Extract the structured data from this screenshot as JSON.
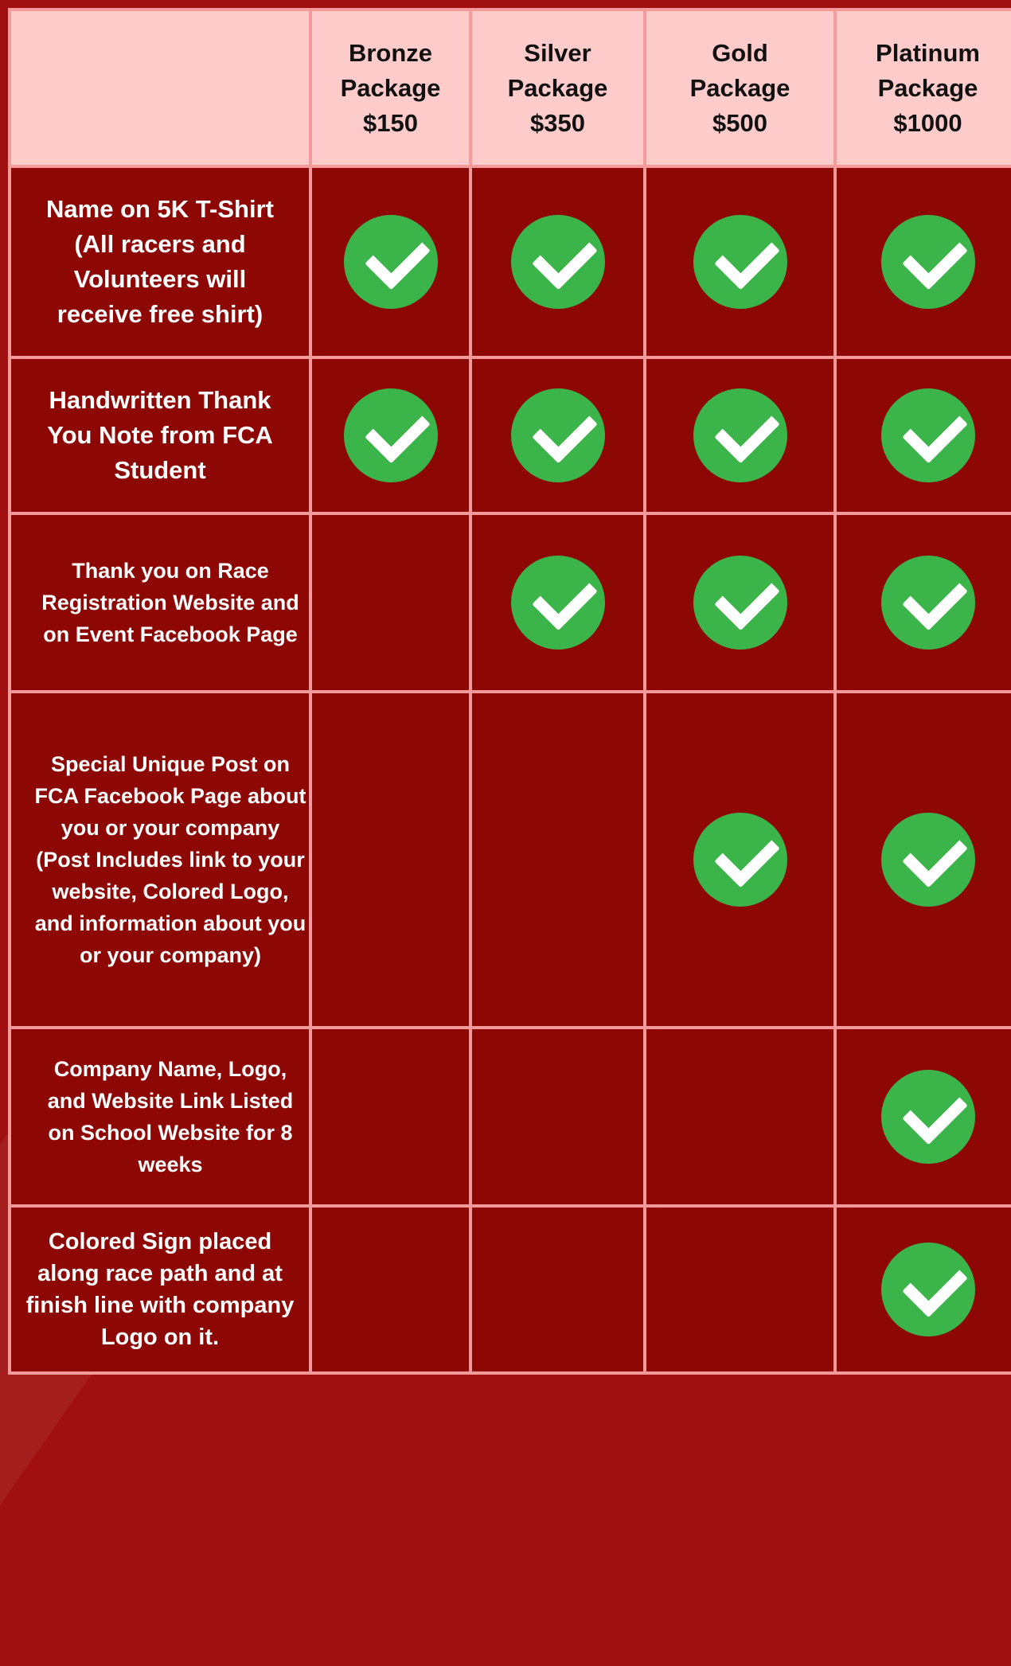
{
  "header": {
    "packages": [
      {
        "line1": "Bronze",
        "line2": "Package",
        "price": "$150"
      },
      {
        "line1": "Silver",
        "line2": "Package",
        "price": "$350"
      },
      {
        "line1": "Gold",
        "line2": "Package",
        "price": "$500"
      },
      {
        "line1": "Platinum",
        "line2": "Package",
        "price": "$1000"
      }
    ]
  },
  "rows": [
    {
      "feature": "Name on 5K T-Shirt (All racers and Volunteers will receive free shirt)",
      "included": [
        true,
        true,
        true,
        true
      ]
    },
    {
      "feature": "Handwritten Thank You Note from FCA Student",
      "included": [
        true,
        true,
        true,
        true
      ]
    },
    {
      "feature": "Thank you on Race Registration Website and on Event Facebook Page",
      "included": [
        false,
        true,
        true,
        true
      ]
    },
    {
      "feature": "Special Unique Post on FCA Facebook Page about you or your company (Post Includes link to your website, Colored Logo, and information about you or your company)",
      "included": [
        false,
        false,
        true,
        true
      ]
    },
    {
      "feature": "Company Name, Logo, and Website Link Listed on School Website for 8 weeks",
      "included": [
        false,
        false,
        false,
        true
      ]
    },
    {
      "feature": "Colored Sign placed along race path and at finish line with company Logo on it.",
      "included": [
        false,
        false,
        false,
        true
      ]
    }
  ],
  "colors": {
    "background": "#8d0705",
    "header_bg": "#fecbcb",
    "grid_lines": "#f59a9a",
    "check_green": "#3bb54a"
  },
  "icons": {
    "check": "check-circle-icon"
  }
}
